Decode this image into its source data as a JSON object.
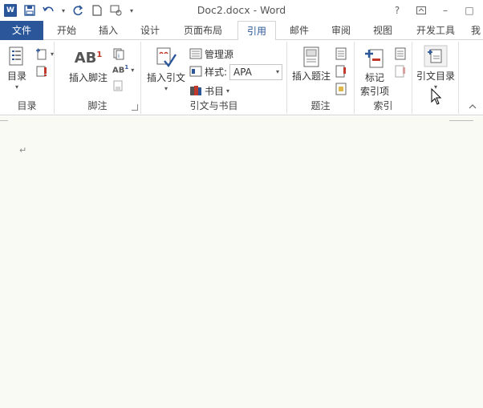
{
  "titlebar": {
    "title": "Doc2.docx - Word",
    "help": "?",
    "minimize": "–",
    "restore": "□",
    "close": "×"
  },
  "tabs": [
    {
      "label": "文件",
      "key": "file"
    },
    {
      "label": "开始",
      "key": "home"
    },
    {
      "label": "插入",
      "key": "insert"
    },
    {
      "label": "设计",
      "key": "design"
    },
    {
      "label": "页面布局",
      "key": "layout"
    },
    {
      "label": "引用",
      "key": "references"
    },
    {
      "label": "邮件",
      "key": "mailings"
    },
    {
      "label": "审阅",
      "key": "review"
    },
    {
      "label": "视图",
      "key": "view"
    },
    {
      "label": "开发工具",
      "key": "developer"
    },
    {
      "label": "我",
      "key": "overflow"
    }
  ],
  "active_tab": "引用",
  "ribbon": {
    "toc": {
      "group_label": "目录",
      "button": "目录"
    },
    "footnotes": {
      "group_label": "脚注",
      "insert_footnote": "插入脚注",
      "ab_label": "AB",
      "sup": "1",
      "next_label": "AB",
      "next_sup": "1"
    },
    "citations": {
      "group_label": "引文与书目",
      "insert_citation": "插入引文",
      "manage_sources": "管理源",
      "style_label": "样式:",
      "style_value": "APA",
      "bibliography": "书目"
    },
    "captions": {
      "group_label": "题注",
      "insert_caption": "插入题注"
    },
    "index": {
      "group_label": "索引",
      "mark_entry_line1": "标记",
      "mark_entry_line2": "索引项"
    },
    "toa": {
      "button": "引文目录"
    }
  },
  "document": {
    "paragraph_mark": "↵"
  },
  "colors": {
    "accent": "#2b579a",
    "doc_bg": "#fafaf5"
  }
}
